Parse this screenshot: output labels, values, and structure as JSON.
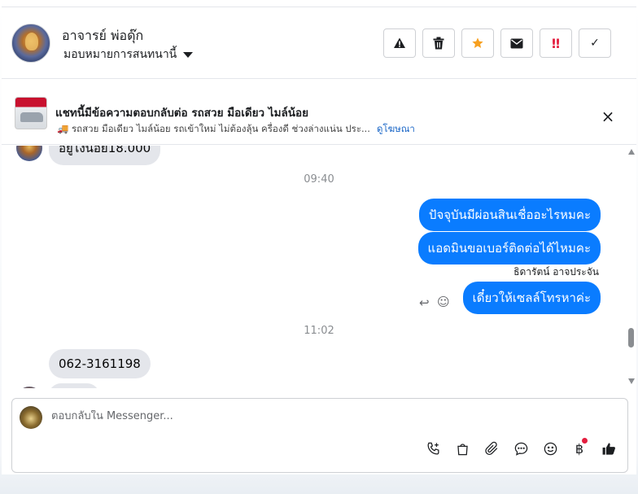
{
  "header": {
    "contact_name": "อาจารย์ พ่อดุ๊ก",
    "assignment_label": "มอบหมายการสนทนานี้",
    "actions": [
      {
        "name": "spam",
        "icon": "warning-icon",
        "glyph": "!"
      },
      {
        "name": "delete",
        "icon": "trash-icon"
      },
      {
        "name": "star",
        "icon": "star-icon",
        "color": "#f7a01f"
      },
      {
        "name": "mark-unread",
        "icon": "envelope-icon"
      },
      {
        "name": "follow-up",
        "icon": "double-exclamation-icon",
        "glyph": "‼",
        "color": "#e41e3f"
      },
      {
        "name": "done",
        "icon": "check-icon",
        "glyph": "✓"
      }
    ]
  },
  "banner": {
    "title": "แชทนี้มีข้อความตอบกลับต่อ รถสวย มือเดียว ไมล์น้อย",
    "description": "🚚 รถสวย มือเดียว ไมล์น้อย รถเข้าใหม่ ไม่ต้องลุ้น ครื่องดี ช่วงล่างแน่น ประ...",
    "link": "ดูโฆษณา",
    "thumb_icon": "car-ad-thumbnail"
  },
  "messages": {
    "partial_top": "อยู่ไงน้อย18.000",
    "time_1": "09:40",
    "out_1": "ปัจจุบันมีผ่อนสินเชื่ออะไรหมคะ",
    "out_2": "แอดมินขอเบอร์ติดต่อได้ไหมคะ",
    "sender_name": "ธิดารัตน์ อาจประจัน",
    "out_3": "เดี๋ยวให้เซลล์โทรหาค่ะ",
    "time_2": "11:02",
    "in_1": "062-3161198",
    "colors": {
      "outgoing": "#0a7cff",
      "incoming": "#e4e6eb"
    }
  },
  "composer": {
    "placeholder": "ตอบกลับใน Messenger...",
    "tools": [
      "phone-plus-icon",
      "shopping-bag-icon",
      "paperclip-icon",
      "chat-bubble-icon",
      "smiley-icon",
      "baht-icon",
      "thumbs-up-icon"
    ]
  }
}
